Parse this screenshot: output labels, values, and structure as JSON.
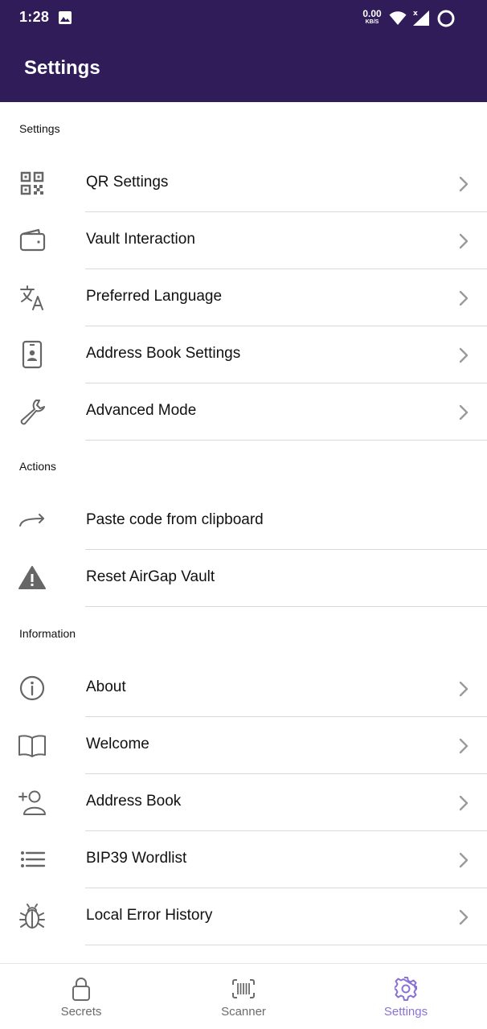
{
  "status_bar": {
    "time": "1:28",
    "net_speed_value": "0.00",
    "net_speed_unit": "KB/S"
  },
  "header": {
    "title": "Settings"
  },
  "sections": {
    "settings": {
      "label": "Settings",
      "items": [
        {
          "label": "QR Settings",
          "icon": "qr-code-icon"
        },
        {
          "label": "Vault Interaction",
          "icon": "wallet-icon"
        },
        {
          "label": "Preferred Language",
          "icon": "translate-icon"
        },
        {
          "label": "Address Book Settings",
          "icon": "contact-card-icon"
        },
        {
          "label": "Advanced Mode",
          "icon": "wrench-icon"
        }
      ]
    },
    "actions": {
      "label": "Actions",
      "items": [
        {
          "label": "Paste code from clipboard",
          "icon": "arrow-forward-icon"
        },
        {
          "label": "Reset AirGap Vault",
          "icon": "warning-icon"
        }
      ]
    },
    "information": {
      "label": "Information",
      "items": [
        {
          "label": "About",
          "icon": "info-icon"
        },
        {
          "label": "Welcome",
          "icon": "book-icon"
        },
        {
          "label": "Address Book",
          "icon": "add-person-icon"
        },
        {
          "label": "BIP39 Wordlist",
          "icon": "list-icon"
        },
        {
          "label": "Local Error History",
          "icon": "bug-icon"
        }
      ]
    }
  },
  "tabbar": {
    "tabs": [
      {
        "label": "Secrets",
        "icon": "lock-icon",
        "active": false
      },
      {
        "label": "Scanner",
        "icon": "barcode-scanner-icon",
        "active": false
      },
      {
        "label": "Settings",
        "icon": "gear-icon",
        "active": true
      }
    ]
  },
  "colors": {
    "header_bg": "#2f1c58",
    "active_tab": "#8a72d8",
    "inactive_tab": "#6b6b6b",
    "icon_gray": "#666666",
    "divider": "#d9d9d9"
  }
}
